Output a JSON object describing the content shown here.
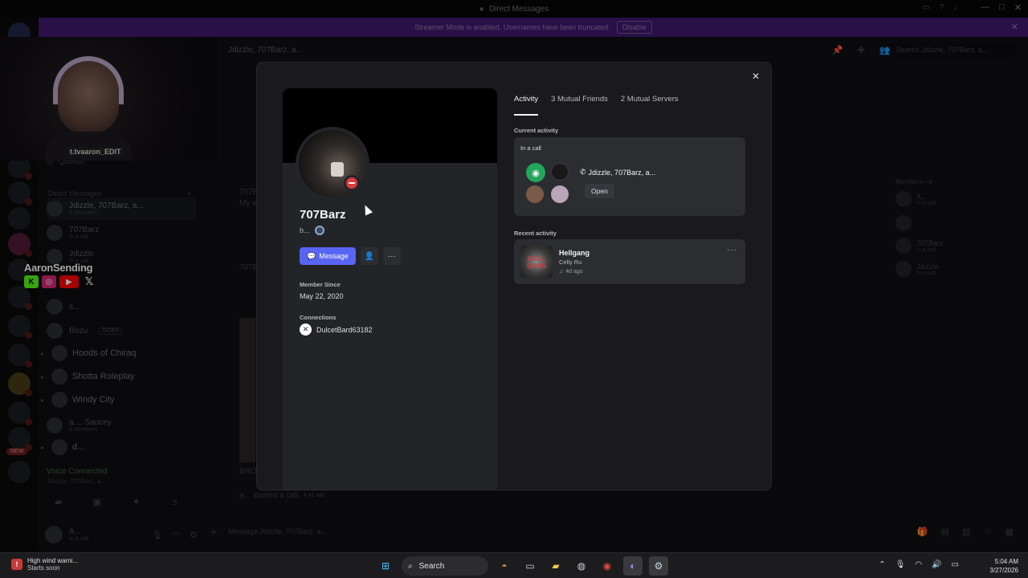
{
  "window": {
    "title": "Direct Messages",
    "banner_text": "Streamer Mode is enabled. Usernames have been truncated.",
    "banner_button": "Disable"
  },
  "sidebar": {
    "quests": "Quests",
    "dm_header": "Direct Messages",
    "dms": [
      {
        "name": "Jdizzle, 707Barz, a...",
        "sub": "4 Members"
      },
      {
        "name": "707Barz",
        "sub": "In a call"
      },
      {
        "name": "Jdizzle",
        "sub": "In a call"
      },
      {
        "name": "s...",
        "sub": ""
      },
      {
        "name": "Rozu",
        "sub": "",
        "tag": "OGEN"
      }
    ],
    "categories": [
      {
        "name": "Hoods of Chiraq"
      },
      {
        "name": "Shotta Roleplay"
      },
      {
        "name": "Windy City"
      },
      {
        "name": "a..., Saucey",
        "sub": "3 Members"
      },
      {
        "name": "d..."
      }
    ],
    "new_badge": "NEW",
    "voice_connected": "Voice Connected",
    "voice_channel": "Jdizzle, 707Barz, a...",
    "user_name": "A...",
    "user_status": "In a call"
  },
  "overlay": {
    "streamer_name": "AaronSending",
    "cam_tag": "t.tvaaron_EDIT"
  },
  "main": {
    "header_title": "Jdizzle, 707Barz, a...",
    "search_placeholder": "Search Jdizzle, 707Barz, a...",
    "bg_lines": [
      "707B",
      "My w",
      "707B",
      "BRO",
      "a... started a call.",
      "4:41 AM"
    ],
    "members_header": "Members—4",
    "members": [
      {
        "name": "A...",
        "sub": "In a call"
      },
      {
        "name": "",
        "sub": ""
      },
      {
        "name": "707Barz",
        "sub": "In a call"
      },
      {
        "name": "Jdizzle",
        "sub": "In a call"
      }
    ],
    "composer_placeholder": "Message Jdizzle, 707Barz, a..."
  },
  "profile": {
    "username": "707Barz",
    "status_text": "b...",
    "message_button": "Message",
    "member_since_label": "Member Since",
    "member_since": "May 22, 2020",
    "connections_label": "Connections",
    "connection_name": "DulcetBard63182",
    "tabs": [
      "Activity",
      "3 Mutual Friends",
      "2 Mutual Servers"
    ],
    "current_activity_label": "Current activity",
    "in_a_call": "In a call",
    "call_name": "Jdizzle, 707Barz, a...",
    "open_button": "Open",
    "recent_activity_label": "Recent activity",
    "recent_title": "Hellgang",
    "recent_artist": "Celly Ru",
    "recent_time": "4d ago",
    "art_text": "HELL GANG"
  },
  "taskbar": {
    "weather_title": "High wind warni...",
    "weather_sub": "Starts soon",
    "search_label": "Search",
    "time": "5:04 AM",
    "date": "3/27/2026"
  }
}
